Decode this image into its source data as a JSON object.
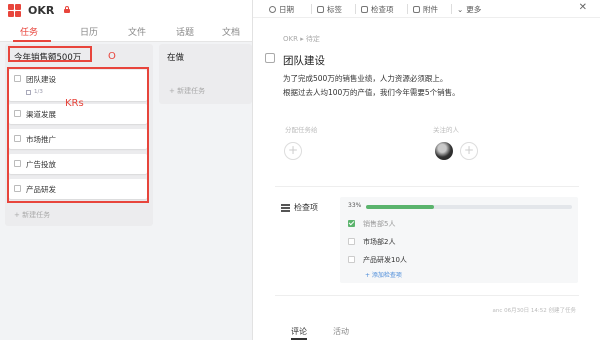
{
  "app": {
    "title": "OKR"
  },
  "tabs": [
    {
      "label": "任务",
      "active": true
    },
    {
      "label": "日历",
      "active": false
    },
    {
      "label": "文件",
      "active": false
    },
    {
      "label": "话题",
      "active": false
    },
    {
      "label": "文档",
      "active": false
    }
  ],
  "board": {
    "objective": "今年销售额500万",
    "objective_mark": "O",
    "kr_mark": "KRs",
    "cards": [
      {
        "label": "团队建设",
        "sub": "1/3"
      },
      {
        "label": "渠道发展"
      },
      {
        "label": "市场推广"
      },
      {
        "label": "广告投放"
      },
      {
        "label": "产品研发"
      }
    ],
    "add_task": "+ 新建任务",
    "doing_title": "在做",
    "doing_add_task": "+ 新建任务"
  },
  "detail": {
    "toolbar": {
      "date": "日期",
      "tag": "标签",
      "checklist": "检查项",
      "attachment": "附件",
      "more": "更多"
    },
    "breadcrumb": "OKR  ▸  待定",
    "title": "团队建设",
    "description": [
      "为了完成500万的销售业绩，人力资源必须跟上。",
      "根据过去人均100万的产值，我们今年需要5个销售。"
    ],
    "assign_label": "分配任务给",
    "followers_label": "关注的人",
    "checklist": {
      "label": "检查项",
      "percent": "33%",
      "progress": 0.33,
      "items": [
        {
          "text": "销售部5人",
          "done": true
        },
        {
          "text": "市场部2人",
          "done": false
        },
        {
          "text": "产品研发10人",
          "done": false
        }
      ],
      "add_label": "+ 添加检查项"
    },
    "footer_meta": "anc 06月30日 14:52 创建了任务",
    "bottom_tabs": [
      "评论",
      "活动"
    ]
  },
  "colors": {
    "accent": "#e8453c",
    "progress": "#5bb46d",
    "link": "#4a8bd9"
  }
}
